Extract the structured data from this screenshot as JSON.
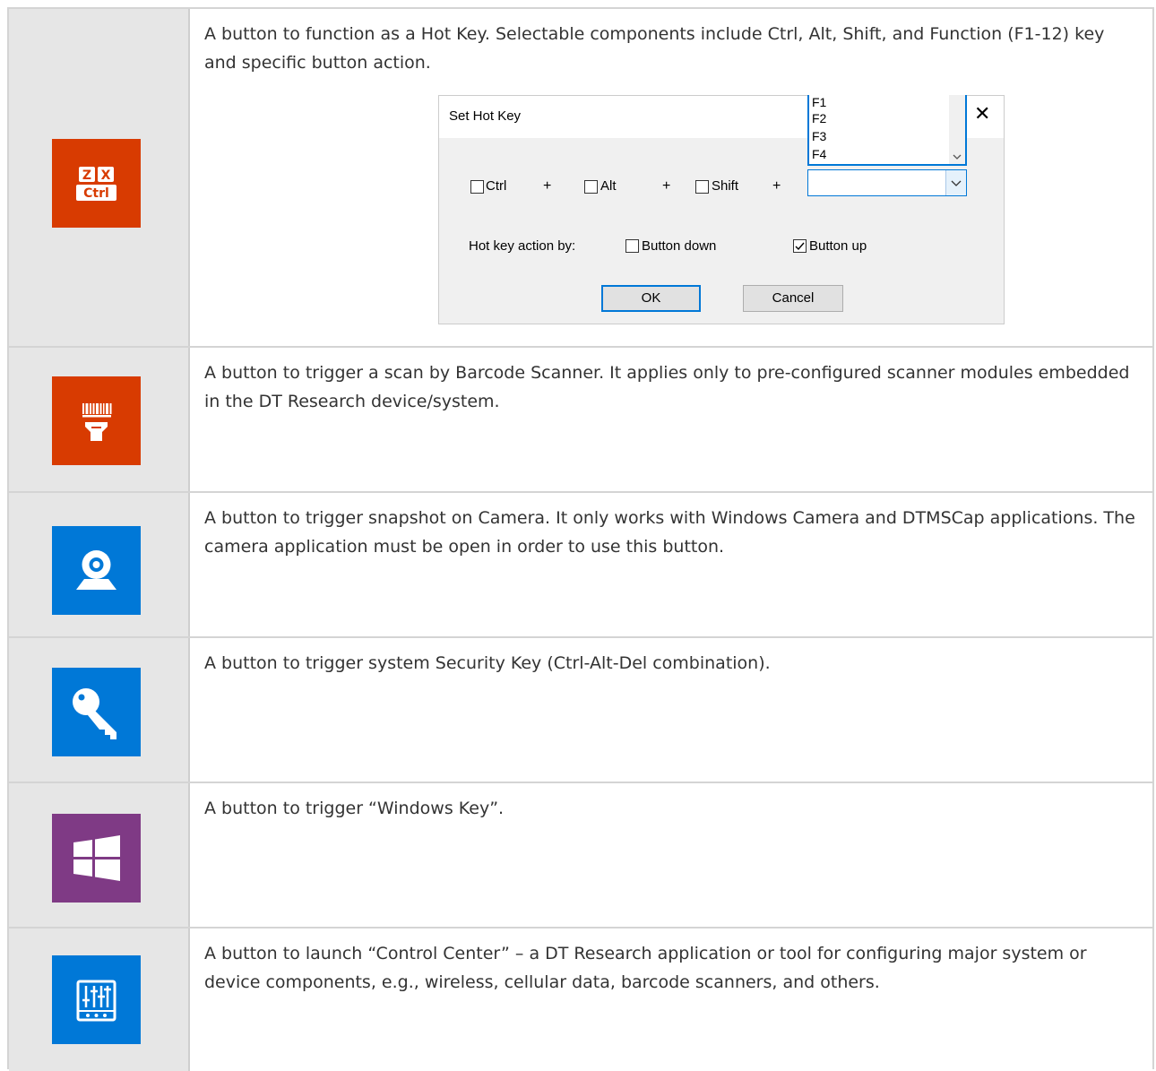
{
  "rows": [
    {
      "icon": "ctrl-hotkey-icon",
      "text": "A button to function as a Hot Key. Selectable components include Ctrl, Alt, Shift, and Function (F1-12) key and specific button action."
    },
    {
      "icon": "barcode-scanner-icon",
      "text": "A button to trigger a scan by Barcode Scanner. It applies only to pre-configured scanner modules embedded in the DT Research device/system."
    },
    {
      "icon": "camera-icon",
      "text": "A button to trigger snapshot on Camera. It only works with Windows Camera and DTMSCap applications. The camera application must be open in order to use this button."
    },
    {
      "icon": "key-icon",
      "text": "A button to trigger system Security Key (Ctrl-Alt-Del combination)."
    },
    {
      "icon": "windows-icon",
      "text": "A button to trigger “Windows Key”."
    },
    {
      "icon": "control-center-icon",
      "text": "A button to launch “Control Center” – a DT Research application or tool for configuring major system or device components, e.g., wireless, cellular data, barcode scanners, and others."
    }
  ],
  "icon_glyphs": {
    "z": "Z",
    "x": "X",
    "ctrl": "Ctrl"
  },
  "dialog": {
    "title": "Set Hot Key",
    "close": "✕",
    "ctrl": "Ctrl",
    "alt": "Alt",
    "shift": "Shift",
    "plus": "+",
    "fkeys": [
      "F1",
      "F2",
      "F3",
      "F4"
    ],
    "action_label": "Hot key action by:",
    "button_down": "Button down",
    "button_up": "Button up",
    "button_down_checked": false,
    "button_up_checked": true,
    "ok": "OK",
    "cancel": "Cancel"
  },
  "colors": {
    "orange": "#d83b01",
    "blue": "#0078d7",
    "purple": "#7f3a85",
    "accent": "#0078d7"
  }
}
